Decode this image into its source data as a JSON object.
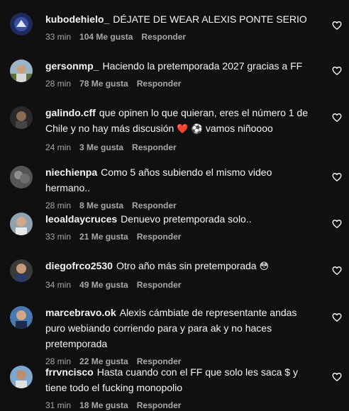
{
  "comments": [
    {
      "user": "kubodehielo_",
      "text": "DÉJATE DE WEAR ALEXIS PONTE SERIO",
      "emoji": "",
      "time": "33 min",
      "likes": "104 Me gusta",
      "reply": "Responder"
    },
    {
      "user": "gersonmp_",
      "text": "Haciendo la pretemporada 2027 gracias a FF",
      "emoji": "",
      "time": "28 min",
      "likes": "78 Me gusta",
      "reply": "Responder"
    },
    {
      "user": "galindo.cff",
      "text": "que opinen lo que quieran, eres el número 1 de Chile y no hay más discusión",
      "emoji": "❤️ ⚽ ",
      "text2": "vamos niñoooo",
      "time": "24 min",
      "likes": "3 Me gusta",
      "reply": "Responder"
    },
    {
      "user": "niechienpa",
      "text": "Como 5 años subiendo el mismo video hermano..",
      "emoji": "",
      "time": "28 min",
      "likes": "8 Me gusta",
      "reply": "Responder"
    },
    {
      "user": "leoaldaycruces",
      "text": "Denuevo pretemporada solo..",
      "emoji": "",
      "time": "33 min",
      "likes": "21 Me gusta",
      "reply": "Responder"
    },
    {
      "user": "diegofrco2530",
      "text": "Otro año más sin pretemporada",
      "emoji": "😳",
      "time": "34 min",
      "likes": "49 Me gusta",
      "reply": "Responder"
    },
    {
      "user": "marcebravo.ok",
      "text": "Alexis cámbiate de representante andas puro webiando corriendo para y para ak y no haces pretemporada",
      "emoji": "",
      "time": "28 min",
      "likes": "22 Me gusta",
      "reply": "Responder"
    },
    {
      "user": "frrvncisco",
      "text": "Hasta cuando con el FF que solo les saca $ y tiene todo el fucking monopolio",
      "emoji": "",
      "time": "31 min",
      "likes": "18 Me gusta",
      "reply": "Responder"
    }
  ],
  "colors": {
    "background": "#101010",
    "text": "#f5f5f5",
    "muted": "#a8a8a8",
    "heart": "#f5f5f5"
  },
  "icons": {
    "heart": "heart-outline-icon",
    "avatar": "user-avatar"
  }
}
